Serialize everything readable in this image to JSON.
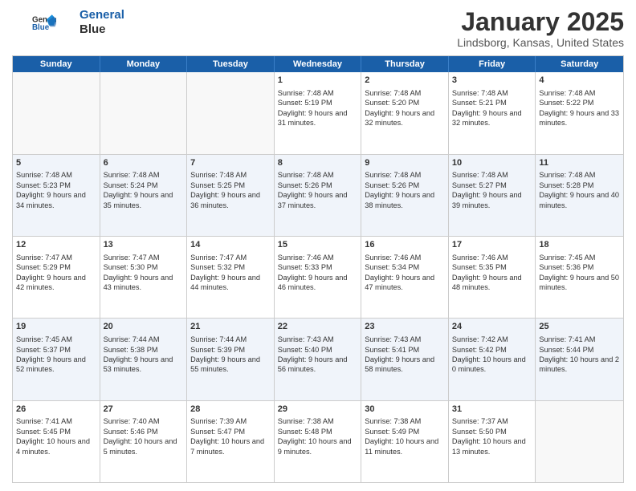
{
  "logo": {
    "line1": "General",
    "line2": "Blue"
  },
  "title": "January 2025",
  "subtitle": "Lindsborg, Kansas, United States",
  "days": [
    "Sunday",
    "Monday",
    "Tuesday",
    "Wednesday",
    "Thursday",
    "Friday",
    "Saturday"
  ],
  "weeks": [
    {
      "alt": false,
      "cells": [
        {
          "day": null,
          "content": ""
        },
        {
          "day": null,
          "content": ""
        },
        {
          "day": null,
          "content": ""
        },
        {
          "day": "1",
          "content": "Sunrise: 7:48 AM\nSunset: 5:19 PM\nDaylight: 9 hours and 31 minutes."
        },
        {
          "day": "2",
          "content": "Sunrise: 7:48 AM\nSunset: 5:20 PM\nDaylight: 9 hours and 32 minutes."
        },
        {
          "day": "3",
          "content": "Sunrise: 7:48 AM\nSunset: 5:21 PM\nDaylight: 9 hours and 32 minutes."
        },
        {
          "day": "4",
          "content": "Sunrise: 7:48 AM\nSunset: 5:22 PM\nDaylight: 9 hours and 33 minutes."
        }
      ]
    },
    {
      "alt": true,
      "cells": [
        {
          "day": "5",
          "content": "Sunrise: 7:48 AM\nSunset: 5:23 PM\nDaylight: 9 hours and 34 minutes."
        },
        {
          "day": "6",
          "content": "Sunrise: 7:48 AM\nSunset: 5:24 PM\nDaylight: 9 hours and 35 minutes."
        },
        {
          "day": "7",
          "content": "Sunrise: 7:48 AM\nSunset: 5:25 PM\nDaylight: 9 hours and 36 minutes."
        },
        {
          "day": "8",
          "content": "Sunrise: 7:48 AM\nSunset: 5:26 PM\nDaylight: 9 hours and 37 minutes."
        },
        {
          "day": "9",
          "content": "Sunrise: 7:48 AM\nSunset: 5:26 PM\nDaylight: 9 hours and 38 minutes."
        },
        {
          "day": "10",
          "content": "Sunrise: 7:48 AM\nSunset: 5:27 PM\nDaylight: 9 hours and 39 minutes."
        },
        {
          "day": "11",
          "content": "Sunrise: 7:48 AM\nSunset: 5:28 PM\nDaylight: 9 hours and 40 minutes."
        }
      ]
    },
    {
      "alt": false,
      "cells": [
        {
          "day": "12",
          "content": "Sunrise: 7:47 AM\nSunset: 5:29 PM\nDaylight: 9 hours and 42 minutes."
        },
        {
          "day": "13",
          "content": "Sunrise: 7:47 AM\nSunset: 5:30 PM\nDaylight: 9 hours and 43 minutes."
        },
        {
          "day": "14",
          "content": "Sunrise: 7:47 AM\nSunset: 5:32 PM\nDaylight: 9 hours and 44 minutes."
        },
        {
          "day": "15",
          "content": "Sunrise: 7:46 AM\nSunset: 5:33 PM\nDaylight: 9 hours and 46 minutes."
        },
        {
          "day": "16",
          "content": "Sunrise: 7:46 AM\nSunset: 5:34 PM\nDaylight: 9 hours and 47 minutes."
        },
        {
          "day": "17",
          "content": "Sunrise: 7:46 AM\nSunset: 5:35 PM\nDaylight: 9 hours and 48 minutes."
        },
        {
          "day": "18",
          "content": "Sunrise: 7:45 AM\nSunset: 5:36 PM\nDaylight: 9 hours and 50 minutes."
        }
      ]
    },
    {
      "alt": true,
      "cells": [
        {
          "day": "19",
          "content": "Sunrise: 7:45 AM\nSunset: 5:37 PM\nDaylight: 9 hours and 52 minutes."
        },
        {
          "day": "20",
          "content": "Sunrise: 7:44 AM\nSunset: 5:38 PM\nDaylight: 9 hours and 53 minutes."
        },
        {
          "day": "21",
          "content": "Sunrise: 7:44 AM\nSunset: 5:39 PM\nDaylight: 9 hours and 55 minutes."
        },
        {
          "day": "22",
          "content": "Sunrise: 7:43 AM\nSunset: 5:40 PM\nDaylight: 9 hours and 56 minutes."
        },
        {
          "day": "23",
          "content": "Sunrise: 7:43 AM\nSunset: 5:41 PM\nDaylight: 9 hours and 58 minutes."
        },
        {
          "day": "24",
          "content": "Sunrise: 7:42 AM\nSunset: 5:42 PM\nDaylight: 10 hours and 0 minutes."
        },
        {
          "day": "25",
          "content": "Sunrise: 7:41 AM\nSunset: 5:44 PM\nDaylight: 10 hours and 2 minutes."
        }
      ]
    },
    {
      "alt": false,
      "cells": [
        {
          "day": "26",
          "content": "Sunrise: 7:41 AM\nSunset: 5:45 PM\nDaylight: 10 hours and 4 minutes."
        },
        {
          "day": "27",
          "content": "Sunrise: 7:40 AM\nSunset: 5:46 PM\nDaylight: 10 hours and 5 minutes."
        },
        {
          "day": "28",
          "content": "Sunrise: 7:39 AM\nSunset: 5:47 PM\nDaylight: 10 hours and 7 minutes."
        },
        {
          "day": "29",
          "content": "Sunrise: 7:38 AM\nSunset: 5:48 PM\nDaylight: 10 hours and 9 minutes."
        },
        {
          "day": "30",
          "content": "Sunrise: 7:38 AM\nSunset: 5:49 PM\nDaylight: 10 hours and 11 minutes."
        },
        {
          "day": "31",
          "content": "Sunrise: 7:37 AM\nSunset: 5:50 PM\nDaylight: 10 hours and 13 minutes."
        },
        {
          "day": null,
          "content": ""
        }
      ]
    }
  ]
}
